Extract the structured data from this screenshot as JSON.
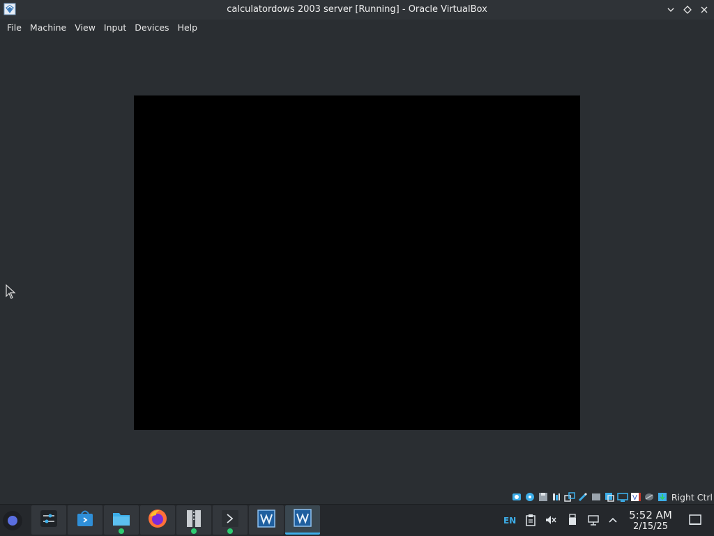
{
  "window": {
    "title": "calculatordows 2003 server [Running] - Oracle VirtualBox"
  },
  "menu": {
    "items": [
      "File",
      "Machine",
      "View",
      "Input",
      "Devices",
      "Help"
    ]
  },
  "status_strip": {
    "host_key_label": "Right Ctrl",
    "icons": [
      "hard-disk-icon",
      "optical-drive-icon",
      "floppy-icon",
      "audio-icon",
      "network-icon",
      "usb-icon",
      "shared-folder-icon",
      "display-icon",
      "recording-icon",
      "virtualization-icon",
      "mouse-integration-icon",
      "keyboard-capture-icon"
    ]
  },
  "taskbar": {
    "apps": [
      "system-settings",
      "discover",
      "file-manager",
      "firefox",
      "archive-manager",
      "terminal",
      "virtualbox-manager",
      "virtualbox-vm"
    ]
  },
  "tray": {
    "language": "EN",
    "time": "5:52 AM",
    "date": "2/15/25"
  },
  "colors": {
    "accent": "#3daee9",
    "background": "#2a2e32",
    "vm_screen": "#000000"
  }
}
